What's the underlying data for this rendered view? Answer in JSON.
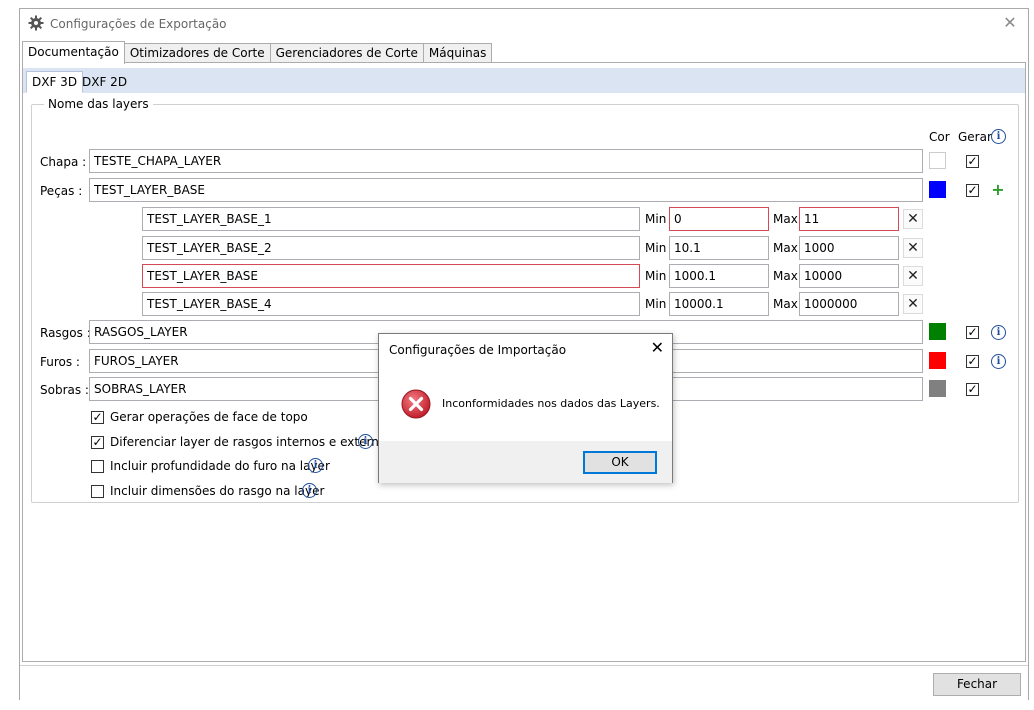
{
  "window": {
    "title": "Configurações de Exportação",
    "close_glyph": "✕",
    "icon": "gear-icon"
  },
  "tabs": [
    {
      "label": "Documentação",
      "active": true
    },
    {
      "label": "Otimizadores de Corte",
      "active": false
    },
    {
      "label": "Gerenciadores de Corte",
      "active": false
    },
    {
      "label": "Máquinas",
      "active": false
    }
  ],
  "subtabs": [
    {
      "label": "DXF 3D",
      "active": true
    },
    {
      "label": "DXF 2D",
      "active": false
    }
  ],
  "group": {
    "legend": "Nome das layers",
    "col_cor": "Cor",
    "col_gerar": "Gerar",
    "info_glyph": "i",
    "plus_glyph": "+",
    "x_glyph": "✕",
    "min_label": "Min",
    "max_label": "Max"
  },
  "layers": {
    "chapa": {
      "label": "Chapa :",
      "value": "TESTE_CHAPA_LAYER",
      "color": "#ffffff",
      "gerar": true
    },
    "pecas": {
      "label": "Peças :",
      "value": "TEST_LAYER_BASE",
      "color": "#0000ff",
      "gerar": true
    },
    "rasgos": {
      "label": "Rasgos :",
      "value": "RASGOS_LAYER",
      "color": "#008000",
      "gerar": true
    },
    "furos": {
      "label": "Furos :",
      "value": "FUROS_LAYER",
      "color": "#ff0000",
      "gerar": true
    },
    "sobras": {
      "label": "Sobras :",
      "value": "SOBRAS_LAYER",
      "color": "#808080",
      "gerar": true
    }
  },
  "sublayers": [
    {
      "name": "TEST_LAYER_BASE_1",
      "min": "0",
      "max": "11",
      "name_error": false,
      "min_error": true,
      "max_error": true
    },
    {
      "name": "TEST_LAYER_BASE_2",
      "min": "10.1",
      "max": "1000",
      "name_error": false,
      "min_error": false,
      "max_error": false
    },
    {
      "name": "TEST_LAYER_BASE",
      "min": "1000.1",
      "max": "10000",
      "name_error": true,
      "min_error": false,
      "max_error": false
    },
    {
      "name": "TEST_LAYER_BASE_4",
      "min": "10000.1",
      "max": "1000000",
      "name_error": false,
      "min_error": false,
      "max_error": false
    }
  ],
  "options": [
    {
      "label": "Gerar operações de face de topo",
      "checked": true,
      "info": false
    },
    {
      "label": "Diferenciar layer de rasgos internos e externos",
      "checked": true,
      "info": true
    },
    {
      "label": "Incluir profundidade do furo na layer",
      "checked": false,
      "info": true
    },
    {
      "label": "Incluir dimensões do rasgo na layer",
      "checked": false,
      "info": true
    }
  ],
  "footer": {
    "close_button": "Fechar"
  },
  "dialog": {
    "title": "Configurações de Importação",
    "close_glyph": "✕",
    "message": "Inconformidades nos dados das Layers.",
    "ok_button": "OK",
    "icon": "error-icon",
    "error_color": "#d1343f"
  }
}
